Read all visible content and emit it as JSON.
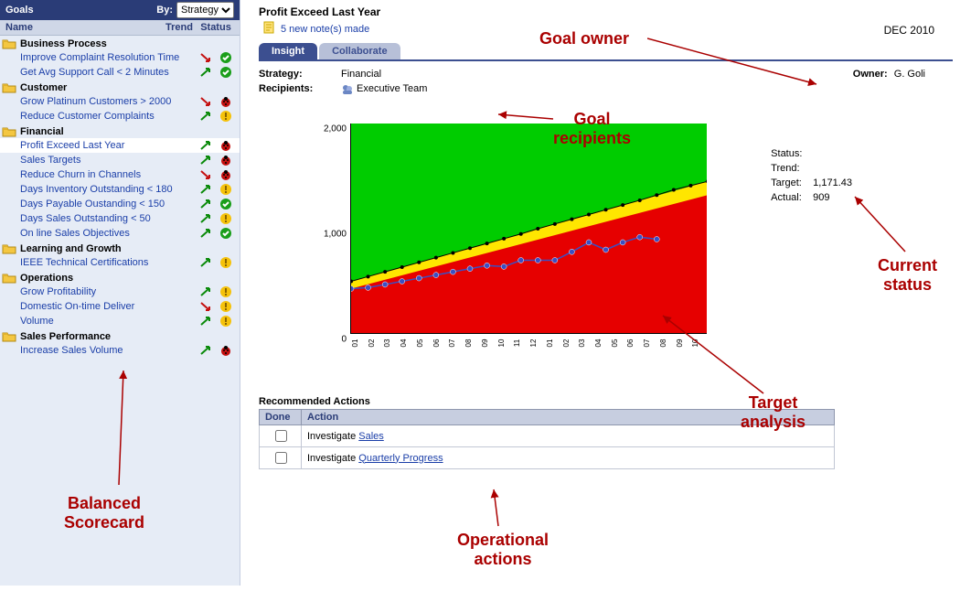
{
  "sidebar": {
    "title": "Goals",
    "by_label": "By:",
    "by_value": "Strategy",
    "col_name": "Name",
    "col_trend": "Trend",
    "col_status": "Status",
    "categories": [
      {
        "name": "Business Process",
        "items": [
          {
            "name": "Improve Complaint Resolution Time",
            "trend": "down",
            "status": "ok"
          },
          {
            "name": "Get Avg Support Call < 2 Minutes",
            "trend": "up",
            "status": "ok"
          }
        ]
      },
      {
        "name": "Customer",
        "items": [
          {
            "name": "Grow Platinum Customers > 2000",
            "trend": "down",
            "status": "ladybug"
          },
          {
            "name": "Reduce Customer Complaints",
            "trend": "up",
            "status": "warn"
          }
        ]
      },
      {
        "name": "Financial",
        "items": [
          {
            "name": "Profit Exceed Last Year",
            "trend": "up",
            "status": "ladybug",
            "selected": true
          },
          {
            "name": "Sales Targets",
            "trend": "up",
            "status": "ladybug"
          },
          {
            "name": "Reduce Churn in Channels",
            "trend": "down",
            "status": "ladybug"
          },
          {
            "name": "Days Inventory Outstanding < 180",
            "trend": "up",
            "status": "warn"
          },
          {
            "name": "Days Payable Oustanding < 150",
            "trend": "up",
            "status": "ok"
          },
          {
            "name": "Days Sales Outstanding < 50",
            "trend": "up",
            "status": "warn"
          },
          {
            "name": "On line Sales Objectives",
            "trend": "up",
            "status": "ok"
          }
        ]
      },
      {
        "name": "Learning and Growth",
        "items": [
          {
            "name": "IEEE Technical Certifications",
            "trend": "up",
            "status": "warn"
          }
        ]
      },
      {
        "name": "Operations",
        "items": [
          {
            "name": "Grow Profitability",
            "trend": "up",
            "status": "warn"
          },
          {
            "name": "Domestic On-time Deliver",
            "trend": "down",
            "status": "warn"
          },
          {
            "name": "Volume",
            "trend": "up",
            "status": "warn"
          }
        ]
      },
      {
        "name": "Sales Performance",
        "items": [
          {
            "name": "Increase Sales Volume",
            "trend": "up",
            "status": "ladybug"
          }
        ]
      }
    ]
  },
  "main": {
    "title": "Profit Exceed Last Year",
    "notes_text": "5 new note(s) made",
    "date": "DEC 2010",
    "tabs": {
      "insight": "Insight",
      "collaborate": "Collaborate"
    },
    "strategy_label": "Strategy:",
    "strategy_value": "Financial",
    "owner_label": "Owner:",
    "owner_value": "G. Goli",
    "recipients_label": "Recipients:",
    "recipients_value": "Executive Team",
    "status": {
      "status_label": "Status:",
      "trend_label": "Trend:",
      "target_label": "Target:",
      "target_value": "1,171.43",
      "actual_label": "Actual:",
      "actual_value": "909"
    },
    "actions": {
      "title": "Recommended Actions",
      "col_done": "Done",
      "col_action": "Action",
      "rows": [
        {
          "prefix": "Investigate ",
          "link": "Sales"
        },
        {
          "prefix": "Investigate ",
          "link": "Quarterly Progress"
        }
      ]
    }
  },
  "annotations": {
    "goal_owner": "Goal owner",
    "goal_recipients": "Goal\nrecipients",
    "current_status": "Current\nstatus",
    "target_analysis": "Target\nanalysis",
    "operational_actions": "Operational\nactions",
    "balanced_scorecard": "Balanced\nScorecard"
  },
  "chart_data": {
    "type": "area-line",
    "title": "",
    "y_ticks": [
      0,
      1000,
      2000
    ],
    "ylim": [
      0,
      2000
    ],
    "x_labels": [
      "01",
      "02",
      "03",
      "04",
      "05",
      "06",
      "07",
      "08",
      "09",
      "10",
      "11",
      "12",
      "01",
      "02",
      "03",
      "04",
      "05",
      "06",
      "07",
      "08",
      "09",
      "10"
    ],
    "bands": [
      {
        "name": "green",
        "color": "#00cc00",
        "start_low": 500,
        "start_high": 2000,
        "end_low": 1450,
        "end_high": 2000
      },
      {
        "name": "yellow",
        "color": "#ffe600",
        "start_low": 430,
        "start_high": 500,
        "end_low": 1320,
        "end_high": 1450
      },
      {
        "name": "red",
        "color": "#e60000",
        "start_low": 200,
        "start_high": 430,
        "end_low": 0,
        "end_high": 1320
      }
    ],
    "series": [
      {
        "name": "Target (dotted)",
        "style": "dot-black",
        "values": [
          500,
          545,
          590,
          635,
          680,
          725,
          770,
          815,
          860,
          905,
          950,
          1000,
          1045,
          1090,
          1135,
          1180,
          1225,
          1270,
          1320,
          1370,
          1410,
          1450
        ]
      },
      {
        "name": "Actual",
        "style": "line-blue",
        "values": [
          430,
          440,
          470,
          500,
          530,
          560,
          590,
          620,
          650,
          640,
          700,
          700,
          700,
          780,
          870,
          800,
          870,
          920,
          900,
          null,
          null,
          null
        ]
      }
    ]
  }
}
